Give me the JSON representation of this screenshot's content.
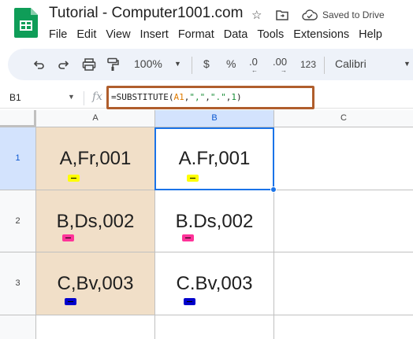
{
  "title_bar": {
    "doc_title": "Tutorial - Computer1001.com",
    "saved_status": "Saved to Drive"
  },
  "menu": [
    "File",
    "Edit",
    "View",
    "Insert",
    "Format",
    "Data",
    "Tools",
    "Extensions",
    "Help"
  ],
  "toolbar": {
    "zoom": "100%",
    "currency": "$",
    "percent": "%",
    "decrease_decimal": ".0",
    "increase_decimal": ".00",
    "number_format": "123",
    "font": "Calibri"
  },
  "formula_bar": {
    "cell_ref": "B1",
    "fx": "fx",
    "formula_prefix": "=SUBSTITUTE(",
    "formula_ref": "A1",
    "formula_sep1": ",",
    "formula_arg2": "\",\"",
    "formula_sep2": ",",
    "formula_arg3": "\".\"",
    "formula_sep3": ",",
    "formula_arg4": "1",
    "formula_suffix": ")"
  },
  "columns": [
    "A",
    "B",
    "C"
  ],
  "rows": [
    "1",
    "2",
    "3"
  ],
  "cells": {
    "a1": "A,Fr,001",
    "b1": "A.Fr,001",
    "a2": "B,Ds,002",
    "b2": "B.Ds,002",
    "a3": "C,Bv,003",
    "b3": "C.Bv,003"
  },
  "colors": {
    "column_a_fill": "#f1dfc8",
    "formula_highlight": "#b05e2c",
    "selection": "#1a73e8",
    "badge_row1": "#ffff00",
    "badge_row2": "#ff3399",
    "badge_row3": "#0000cc"
  }
}
